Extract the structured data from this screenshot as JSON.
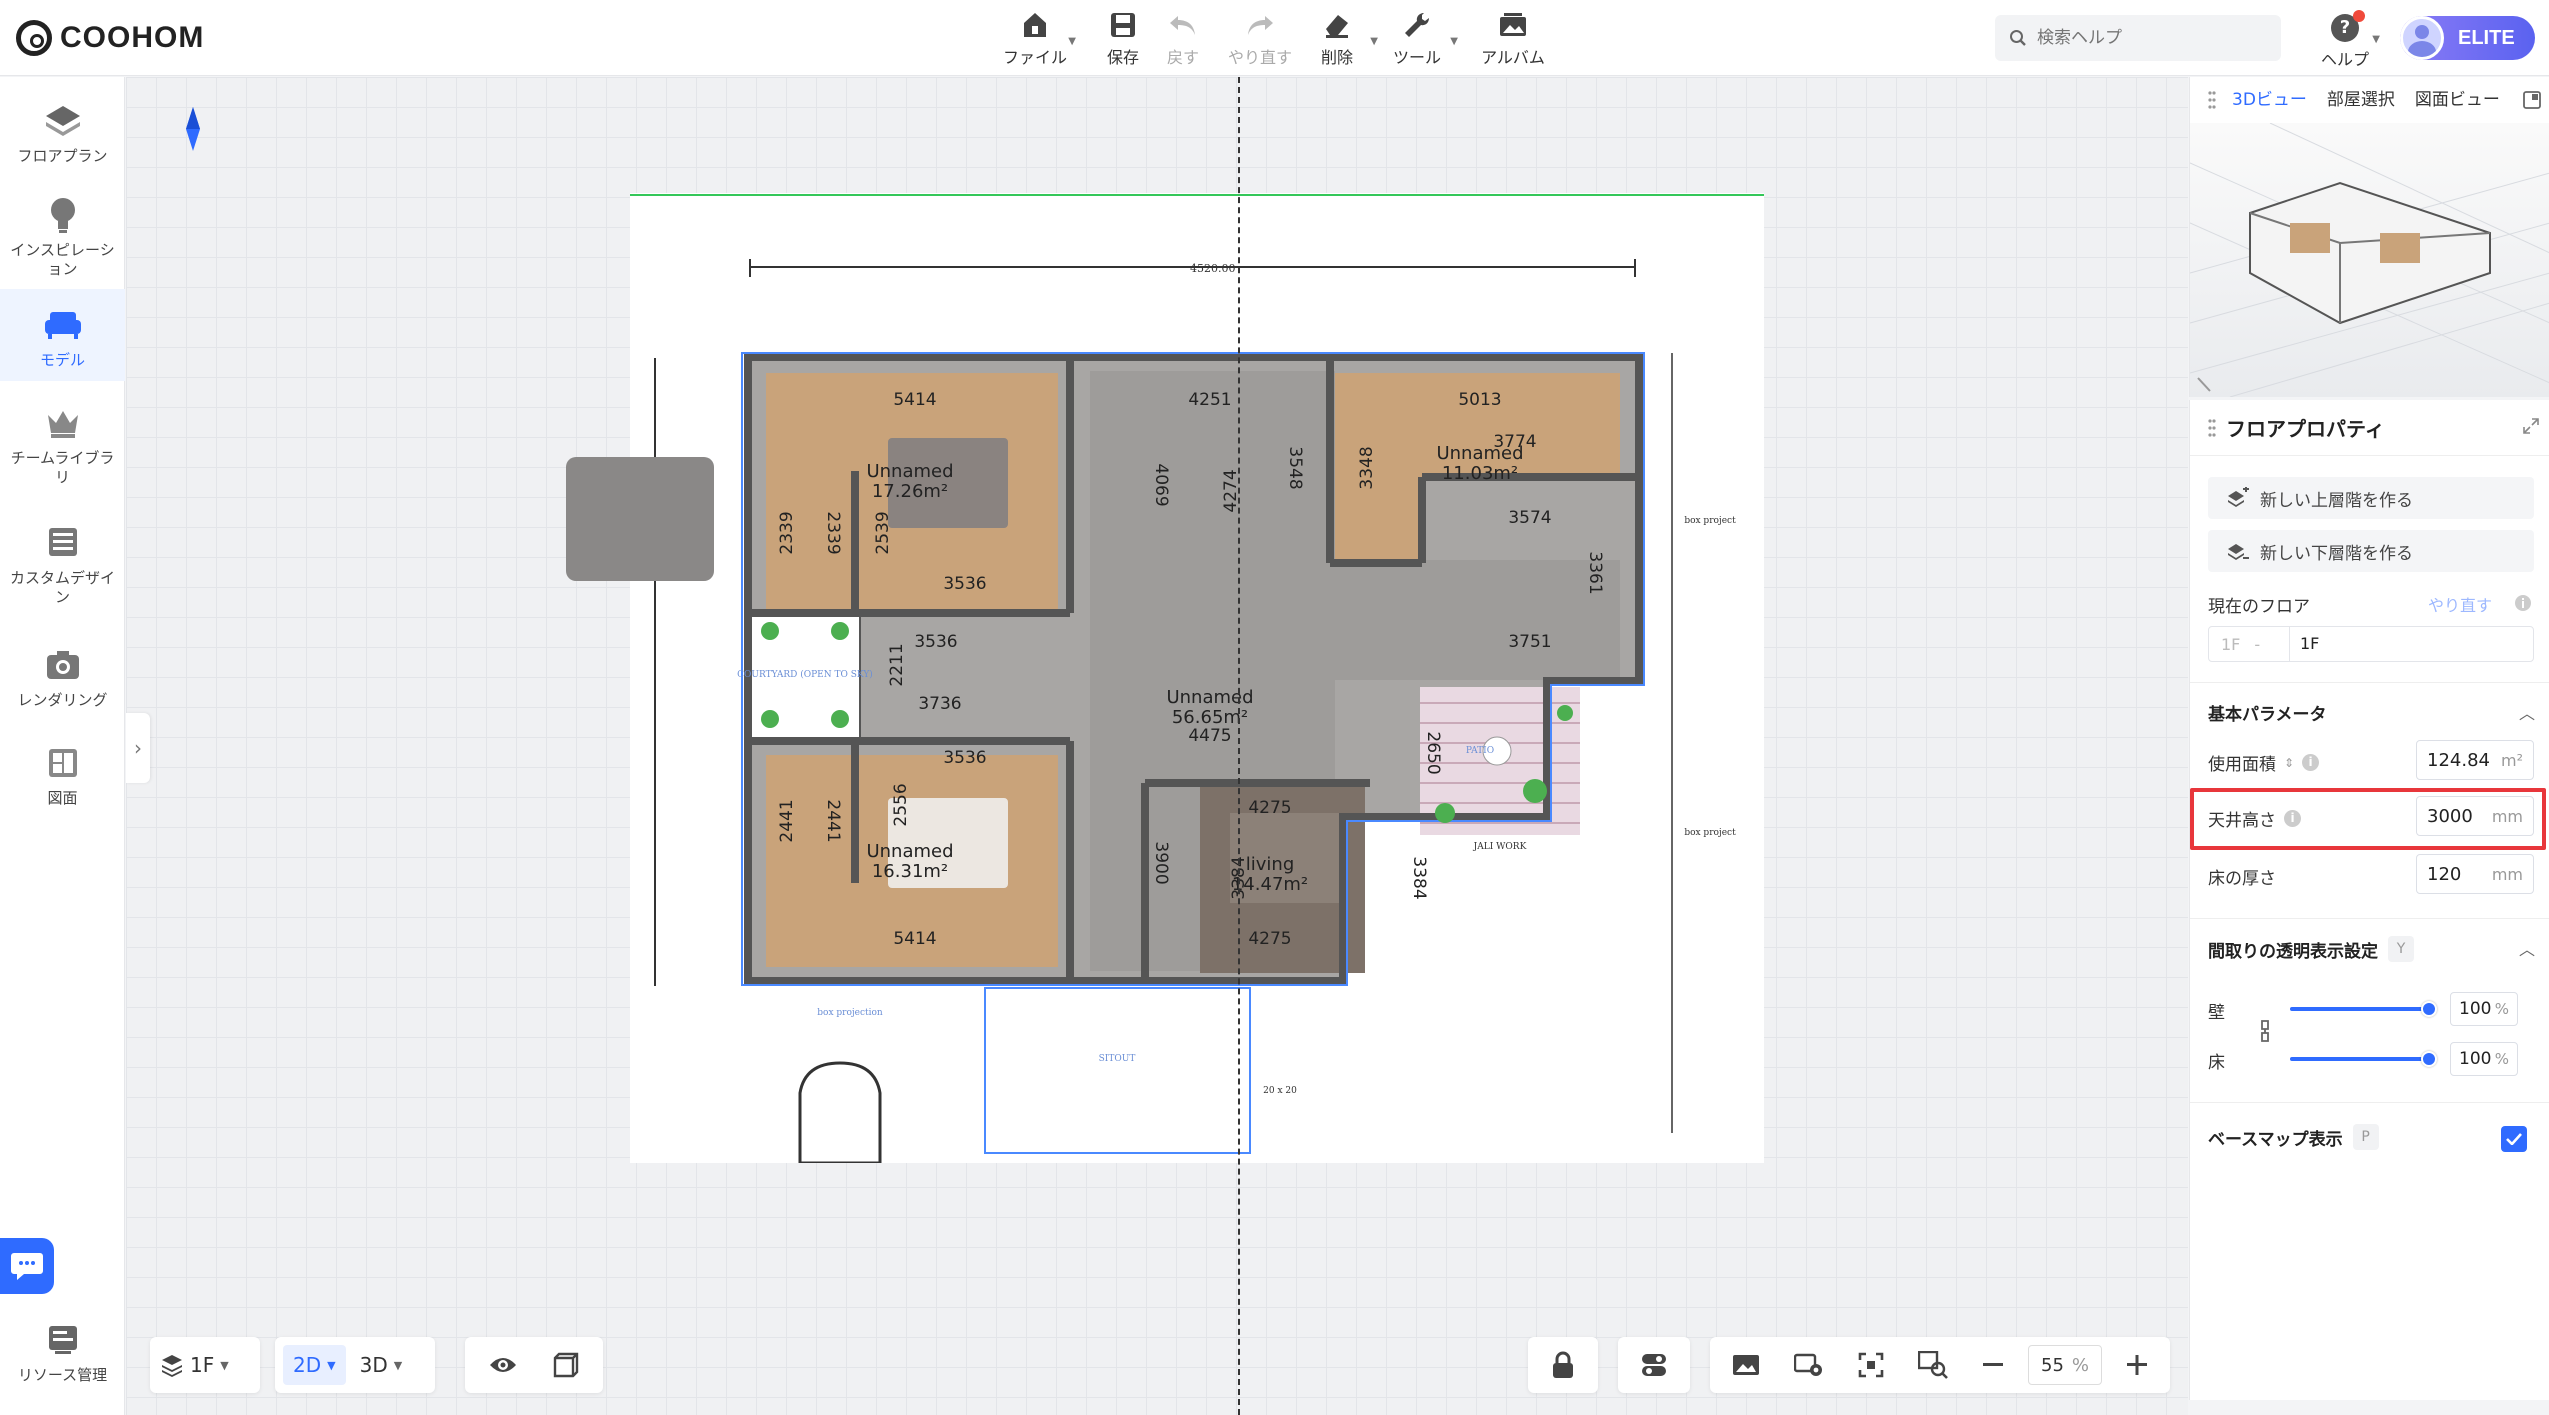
{
  "app": {
    "logo": "COOHOM"
  },
  "toolbar": [
    {
      "name": "file",
      "label": "ファイル",
      "caret": true
    },
    {
      "name": "save",
      "label": "保存",
      "caret": false
    },
    {
      "name": "undo",
      "label": "戻す",
      "caret": false,
      "disabled": true
    },
    {
      "name": "redo",
      "label": "やり直す",
      "caret": false,
      "disabled": true
    },
    {
      "name": "delete",
      "label": "削除",
      "caret": true
    },
    {
      "name": "tools",
      "label": "ツール",
      "caret": true
    },
    {
      "name": "album",
      "label": "アルバム",
      "caret": false
    }
  ],
  "search": {
    "placeholder": "検索ヘルプ"
  },
  "help": {
    "label": "ヘルプ"
  },
  "account": {
    "badge": "ELITE"
  },
  "sidebar": {
    "items": [
      {
        "label": "フロアプラン",
        "icon": "floorplan-icon"
      },
      {
        "label": "インスピレーション",
        "icon": "lightbulb-icon"
      },
      {
        "label": "モデル",
        "icon": "sofa-icon",
        "active": true
      },
      {
        "label": "チームライブラリ",
        "icon": "crown-icon"
      },
      {
        "label": "カスタムデザイン",
        "icon": "cabinet-icon"
      },
      {
        "label": "レンダリング",
        "icon": "camera-icon"
      },
      {
        "label": "図面",
        "icon": "drawing-icon"
      }
    ],
    "resource": {
      "label": "リソース管理"
    }
  },
  "plan": {
    "rooms": [
      {
        "name": "Unnamed",
        "area": "17.26m²"
      },
      {
        "name": "Unnamed",
        "area": "11.03m²"
      },
      {
        "name": "Unnamed",
        "area": "56.65m²"
      },
      {
        "name": "Unnamed",
        "area": "16.31m²"
      },
      {
        "name": "living",
        "area": "14.47m²"
      }
    ],
    "dims": [
      "5414",
      "4251",
      "5013",
      "3774",
      "3548",
      "3348",
      "4274",
      "4069",
      "2539",
      "2339",
      "2339",
      "3536",
      "3574",
      "3361",
      "3536",
      "2211",
      "3736",
      "3751",
      "4475",
      "2650",
      "3536",
      "2556",
      "2441",
      "2441",
      "3900",
      "4275",
      "3384",
      "3384",
      "4275",
      "5414"
    ],
    "labels": {
      "top_width": "4520.00",
      "courtyard": "COURTYARD\n(OPEN TO SKY)",
      "patio": "PATIO",
      "sitout": "SITOUT",
      "jali": "JALI WORK",
      "box_projection": "box projection",
      "box_project_1": "box project",
      "box_project_2": "box project",
      "post": "20 x 20"
    }
  },
  "bottom": {
    "floor": "1F",
    "mode_2d": "2D",
    "mode_3d": "3D",
    "zoom": {
      "value": "55",
      "unit": "%"
    }
  },
  "preview": {
    "tabs": [
      {
        "label": "3Dビュー",
        "active": true
      },
      {
        "label": "部屋選択",
        "active": false
      },
      {
        "label": "図面ビュー",
        "active": false
      }
    ]
  },
  "properties": {
    "title": "フロアプロパティ",
    "add_upper": "新しい上層階を作る",
    "add_lower": "新しい下層階を作る",
    "current_floor": {
      "label": "現在のフロア",
      "redo": "やり直す",
      "prefix": "1F",
      "value": "1F"
    },
    "basic": {
      "title": "基本パラメータ",
      "area": {
        "label": "使用面積",
        "value": "124.84",
        "unit": "m²"
      },
      "ceiling": {
        "label": "天井高さ",
        "value": "3000",
        "unit": "mm"
      },
      "floor_thickness": {
        "label": "床の厚さ",
        "value": "120",
        "unit": "mm"
      }
    },
    "transparency": {
      "title": "間取りの透明表示設定",
      "key": "Y",
      "wall": {
        "label": "壁",
        "value": "100",
        "unit": "%"
      },
      "floor": {
        "label": "床",
        "value": "100",
        "unit": "%"
      }
    },
    "basemap": {
      "label": "ベースマップ表示",
      "key": "P",
      "checked": true
    }
  },
  "colors": {
    "accent": "#2f6bff",
    "highlight": "#e8363b",
    "wood": "#c9a37a",
    "floor_grey": "#a8a6a4"
  }
}
